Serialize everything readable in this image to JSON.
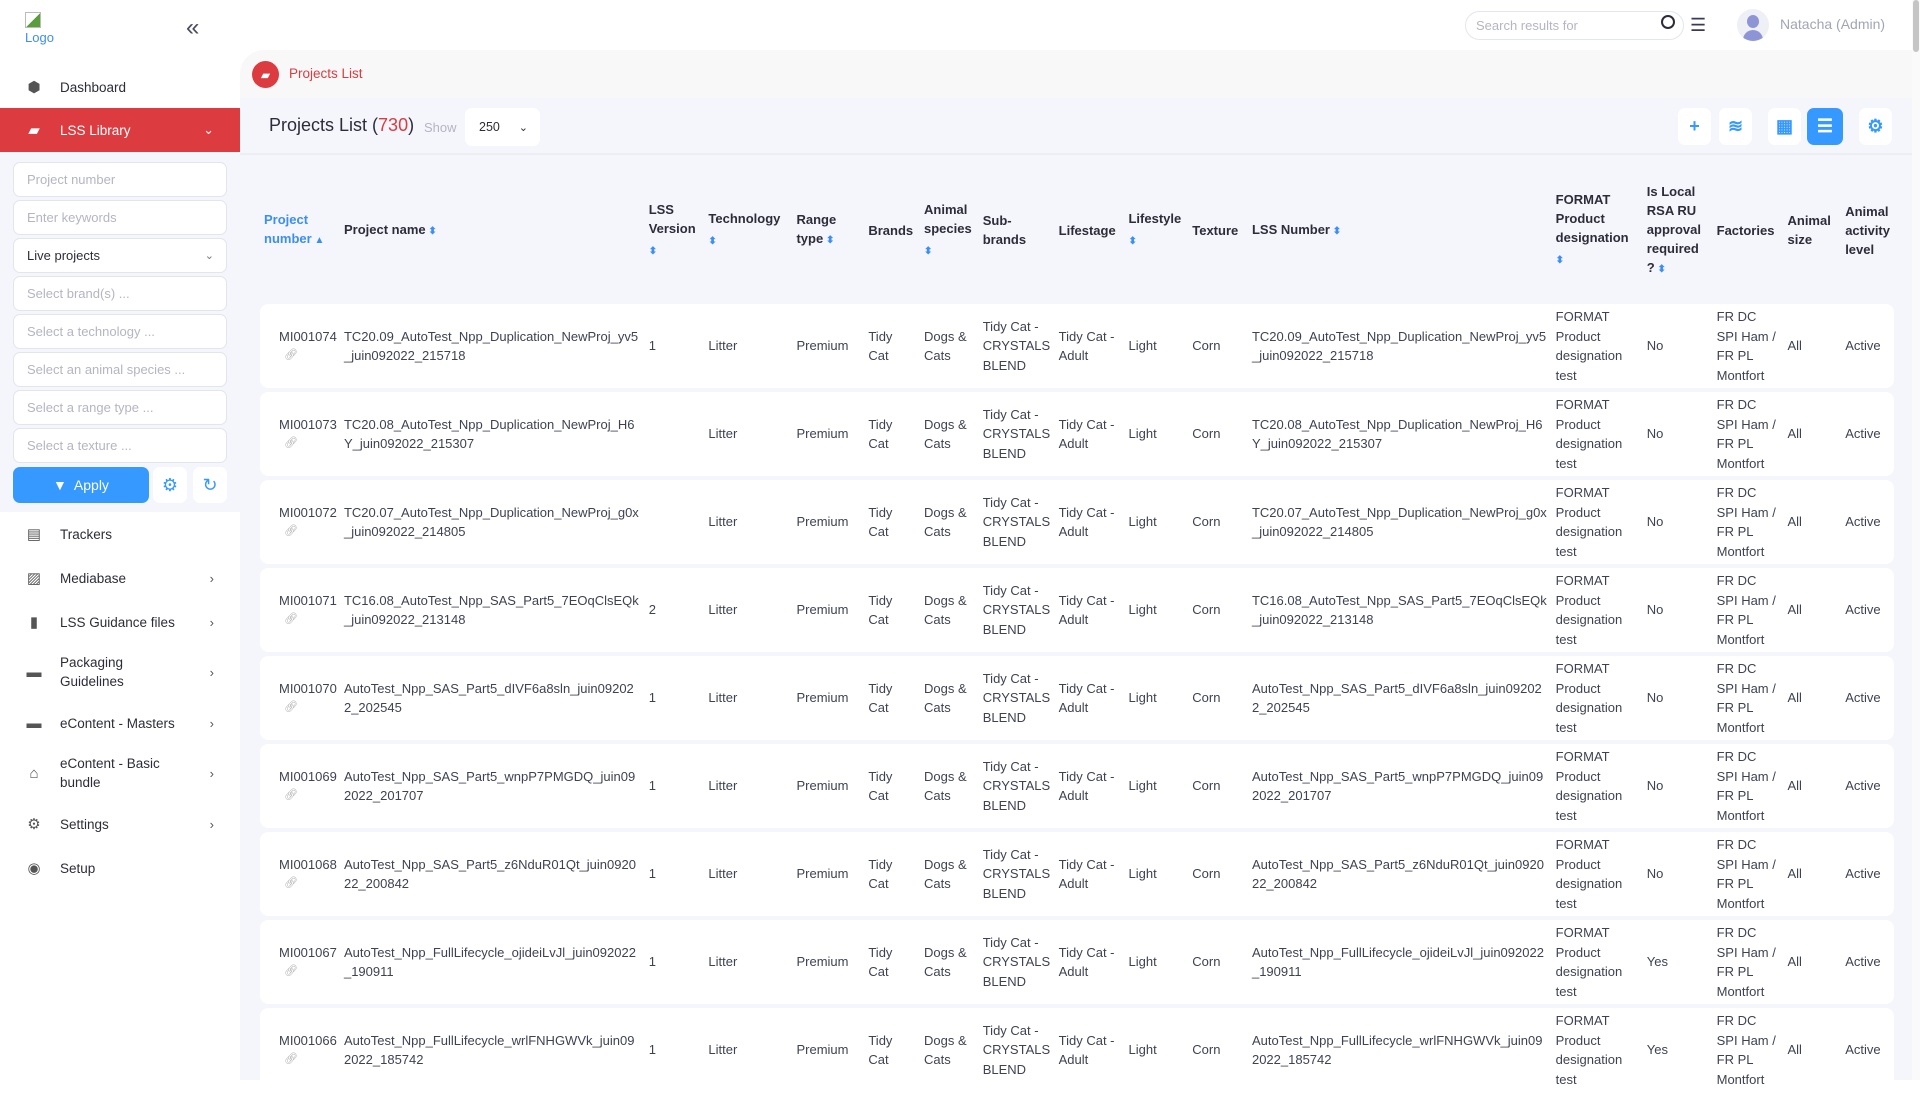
{
  "sidebar": {
    "logo_alt": "Logo",
    "nav_top": [
      {
        "label": "Dashboard"
      },
      {
        "label": "LSS Library"
      }
    ],
    "filters": {
      "project_number_placeholder": "Project number",
      "keywords_placeholder": "Enter keywords",
      "status_value": "Live projects",
      "brands_placeholder": "Select brand(s) ...",
      "technology_placeholder": "Select a technology ...",
      "species_placeholder": "Select an animal species ...",
      "range_placeholder": "Select a range type ...",
      "texture_placeholder": "Select a texture ...",
      "apply_label": "Apply"
    },
    "nav": [
      {
        "label": "Trackers"
      },
      {
        "label": "Mediabase"
      },
      {
        "label": "LSS Guidance files"
      },
      {
        "label": "Packaging Guidelines"
      },
      {
        "label": "eContent - Masters"
      },
      {
        "label": "eContent - Basic bundle"
      },
      {
        "label": "Settings"
      },
      {
        "label": "Setup"
      }
    ]
  },
  "topbar": {
    "search_placeholder": "Search results for",
    "user": "Natacha (Admin)"
  },
  "breadcrumb": "Projects List",
  "page": {
    "title": "Projects List",
    "count": "730",
    "show_label": "Show",
    "show_value": "250"
  },
  "colors": {
    "accent": "#3699ff",
    "brand_red": "#dc3b3f"
  },
  "columns": [
    "Project number",
    "Project name",
    "LSS Version",
    "Technology",
    "Range type",
    "Brands",
    "Animal species",
    "Sub-brands",
    "Lifestage",
    "Lifestyle",
    "Texture",
    "LSS Number",
    "FORMAT Product designation",
    "Is Local RSA RU approval required ?",
    "Factories",
    "Animal size",
    "Animal activity level"
  ],
  "rows": [
    {
      "number": "MI001074",
      "name": "TC20.09_AutoTest_Npp_Duplication_NewProj_yv5_juin092022_215718",
      "version": "1",
      "technology": "Litter",
      "range": "Premium",
      "brands": "Tidy Cat",
      "species": "Dogs & Cats",
      "subbrands": "Tidy Cat - CRYSTALS BLEND",
      "lifestage": "Tidy Cat - Adult",
      "lifestyle": "Light",
      "texture": "Corn",
      "lss_number": "TC20.09_AutoTest_Npp_Duplication_NewProj_yv5_juin092022_215718",
      "format": "FORMAT Product designation test",
      "approval": "No",
      "factories": "FR DC SPI Ham / FR PL Montfort",
      "size": "All",
      "activity": "Active"
    },
    {
      "number": "MI001073",
      "name": "TC20.08_AutoTest_Npp_Duplication_NewProj_H6Y_juin092022_215307",
      "version": "",
      "technology": "Litter",
      "range": "Premium",
      "brands": "Tidy Cat",
      "species": "Dogs & Cats",
      "subbrands": "Tidy Cat - CRYSTALS BLEND",
      "lifestage": "Tidy Cat - Adult",
      "lifestyle": "Light",
      "texture": "Corn",
      "lss_number": "TC20.08_AutoTest_Npp_Duplication_NewProj_H6Y_juin092022_215307",
      "format": "FORMAT Product designation test",
      "approval": "No",
      "factories": "FR DC SPI Ham / FR PL Montfort",
      "size": "All",
      "activity": "Active"
    },
    {
      "number": "MI001072",
      "name": "TC20.07_AutoTest_Npp_Duplication_NewProj_g0x_juin092022_214805",
      "version": "",
      "technology": "Litter",
      "range": "Premium",
      "brands": "Tidy Cat",
      "species": "Dogs & Cats",
      "subbrands": "Tidy Cat - CRYSTALS BLEND",
      "lifestage": "Tidy Cat - Adult",
      "lifestyle": "Light",
      "texture": "Corn",
      "lss_number": "TC20.07_AutoTest_Npp_Duplication_NewProj_g0x_juin092022_214805",
      "format": "FORMAT Product designation test",
      "approval": "No",
      "factories": "FR DC SPI Ham / FR PL Montfort",
      "size": "All",
      "activity": "Active"
    },
    {
      "number": "MI001071",
      "name": "TC16.08_AutoTest_Npp_SAS_Part5_7EOqClsEQk_juin092022_213148",
      "version": "2",
      "technology": "Litter",
      "range": "Premium",
      "brands": "Tidy Cat",
      "species": "Dogs & Cats",
      "subbrands": "Tidy Cat - CRYSTALS BLEND",
      "lifestage": "Tidy Cat - Adult",
      "lifestyle": "Light",
      "texture": "Corn",
      "lss_number": "TC16.08_AutoTest_Npp_SAS_Part5_7EOqClsEQk_juin092022_213148",
      "format": "FORMAT Product designation test",
      "approval": "No",
      "factories": "FR DC SPI Ham / FR PL Montfort",
      "size": "All",
      "activity": "Active"
    },
    {
      "number": "MI001070",
      "name": "AutoTest_Npp_SAS_Part5_dIVF6a8sln_juin092022_202545",
      "version": "1",
      "technology": "Litter",
      "range": "Premium",
      "brands": "Tidy Cat",
      "species": "Dogs & Cats",
      "subbrands": "Tidy Cat - CRYSTALS BLEND",
      "lifestage": "Tidy Cat - Adult",
      "lifestyle": "Light",
      "texture": "Corn",
      "lss_number": "AutoTest_Npp_SAS_Part5_dIVF6a8sln_juin092022_202545",
      "format": "FORMAT Product designation test",
      "approval": "No",
      "factories": "FR DC SPI Ham / FR PL Montfort",
      "size": "All",
      "activity": "Active"
    },
    {
      "number": "MI001069",
      "name": "AutoTest_Npp_SAS_Part5_wnpP7PMGDQ_juin092022_201707",
      "version": "1",
      "technology": "Litter",
      "range": "Premium",
      "brands": "Tidy Cat",
      "species": "Dogs & Cats",
      "subbrands": "Tidy Cat - CRYSTALS BLEND",
      "lifestage": "Tidy Cat - Adult",
      "lifestyle": "Light",
      "texture": "Corn",
      "lss_number": "AutoTest_Npp_SAS_Part5_wnpP7PMGDQ_juin092022_201707",
      "format": "FORMAT Product designation test",
      "approval": "No",
      "factories": "FR DC SPI Ham / FR PL Montfort",
      "size": "All",
      "activity": "Active"
    },
    {
      "number": "MI001068",
      "name": "AutoTest_Npp_SAS_Part5_z6NduR01Qt_juin092022_200842",
      "version": "1",
      "technology": "Litter",
      "range": "Premium",
      "brands": "Tidy Cat",
      "species": "Dogs & Cats",
      "subbrands": "Tidy Cat - CRYSTALS BLEND",
      "lifestage": "Tidy Cat - Adult",
      "lifestyle": "Light",
      "texture": "Corn",
      "lss_number": "AutoTest_Npp_SAS_Part5_z6NduR01Qt_juin092022_200842",
      "format": "FORMAT Product designation test",
      "approval": "No",
      "factories": "FR DC SPI Ham / FR PL Montfort",
      "size": "All",
      "activity": "Active"
    },
    {
      "number": "MI001067",
      "name": "AutoTest_Npp_FullLifecycle_ojideiLvJl_juin092022_190911",
      "version": "1",
      "technology": "Litter",
      "range": "Premium",
      "brands": "Tidy Cat",
      "species": "Dogs & Cats",
      "subbrands": "Tidy Cat - CRYSTALS BLEND",
      "lifestage": "Tidy Cat - Adult",
      "lifestyle": "Light",
      "texture": "Corn",
      "lss_number": "AutoTest_Npp_FullLifecycle_ojideiLvJl_juin092022_190911",
      "format": "FORMAT Product designation test",
      "approval": "Yes",
      "factories": "FR DC SPI Ham / FR PL Montfort",
      "size": "All",
      "activity": "Active"
    },
    {
      "number": "MI001066",
      "name": "AutoTest_Npp_FullLifecycle_wrlFNHGWVk_juin092022_185742",
      "version": "1",
      "technology": "Litter",
      "range": "Premium",
      "brands": "Tidy Cat",
      "species": "Dogs & Cats",
      "subbrands": "Tidy Cat - CRYSTALS BLEND",
      "lifestage": "Tidy Cat - Adult",
      "lifestyle": "Light",
      "texture": "Corn",
      "lss_number": "AutoTest_Npp_FullLifecycle_wrlFNHGWVk_juin092022_185742",
      "format": "FORMAT Product designation test",
      "approval": "Yes",
      "factories": "FR DC SPI Ham / FR PL Montfort",
      "size": "All",
      "activity": "Active"
    }
  ]
}
